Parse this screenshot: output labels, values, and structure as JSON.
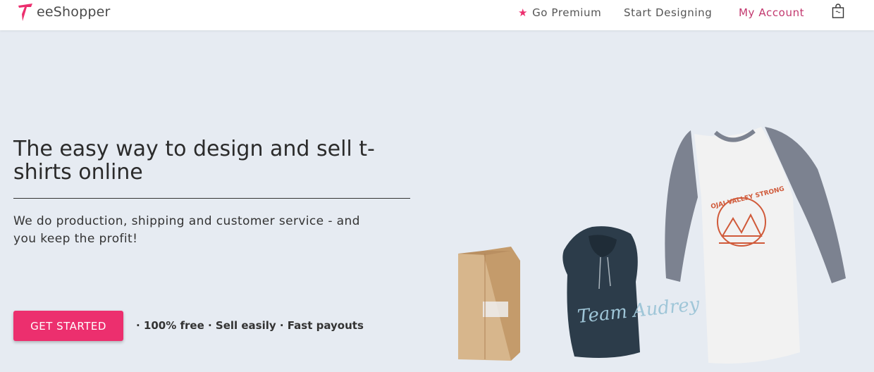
{
  "header": {
    "logo_text": "eeShopper",
    "nav": {
      "premium": "Go Premium",
      "design": "Start Designing",
      "account": "My Account"
    }
  },
  "hero": {
    "headline": "The easy way to design and sell t-shirts online",
    "subtext": "We do production, shipping and customer service - and you keep the profit!",
    "cta": "GET STARTED",
    "features": "· 100% free · Sell easily · Fast payouts"
  },
  "products": {
    "hoodie_text": "Team Audrey",
    "shirt_text": "OJAI VALLEY STRONG"
  },
  "colors": {
    "accent": "#ec2f6e",
    "account_link": "#c2386e",
    "hero_bg": "#e6ebf2"
  }
}
